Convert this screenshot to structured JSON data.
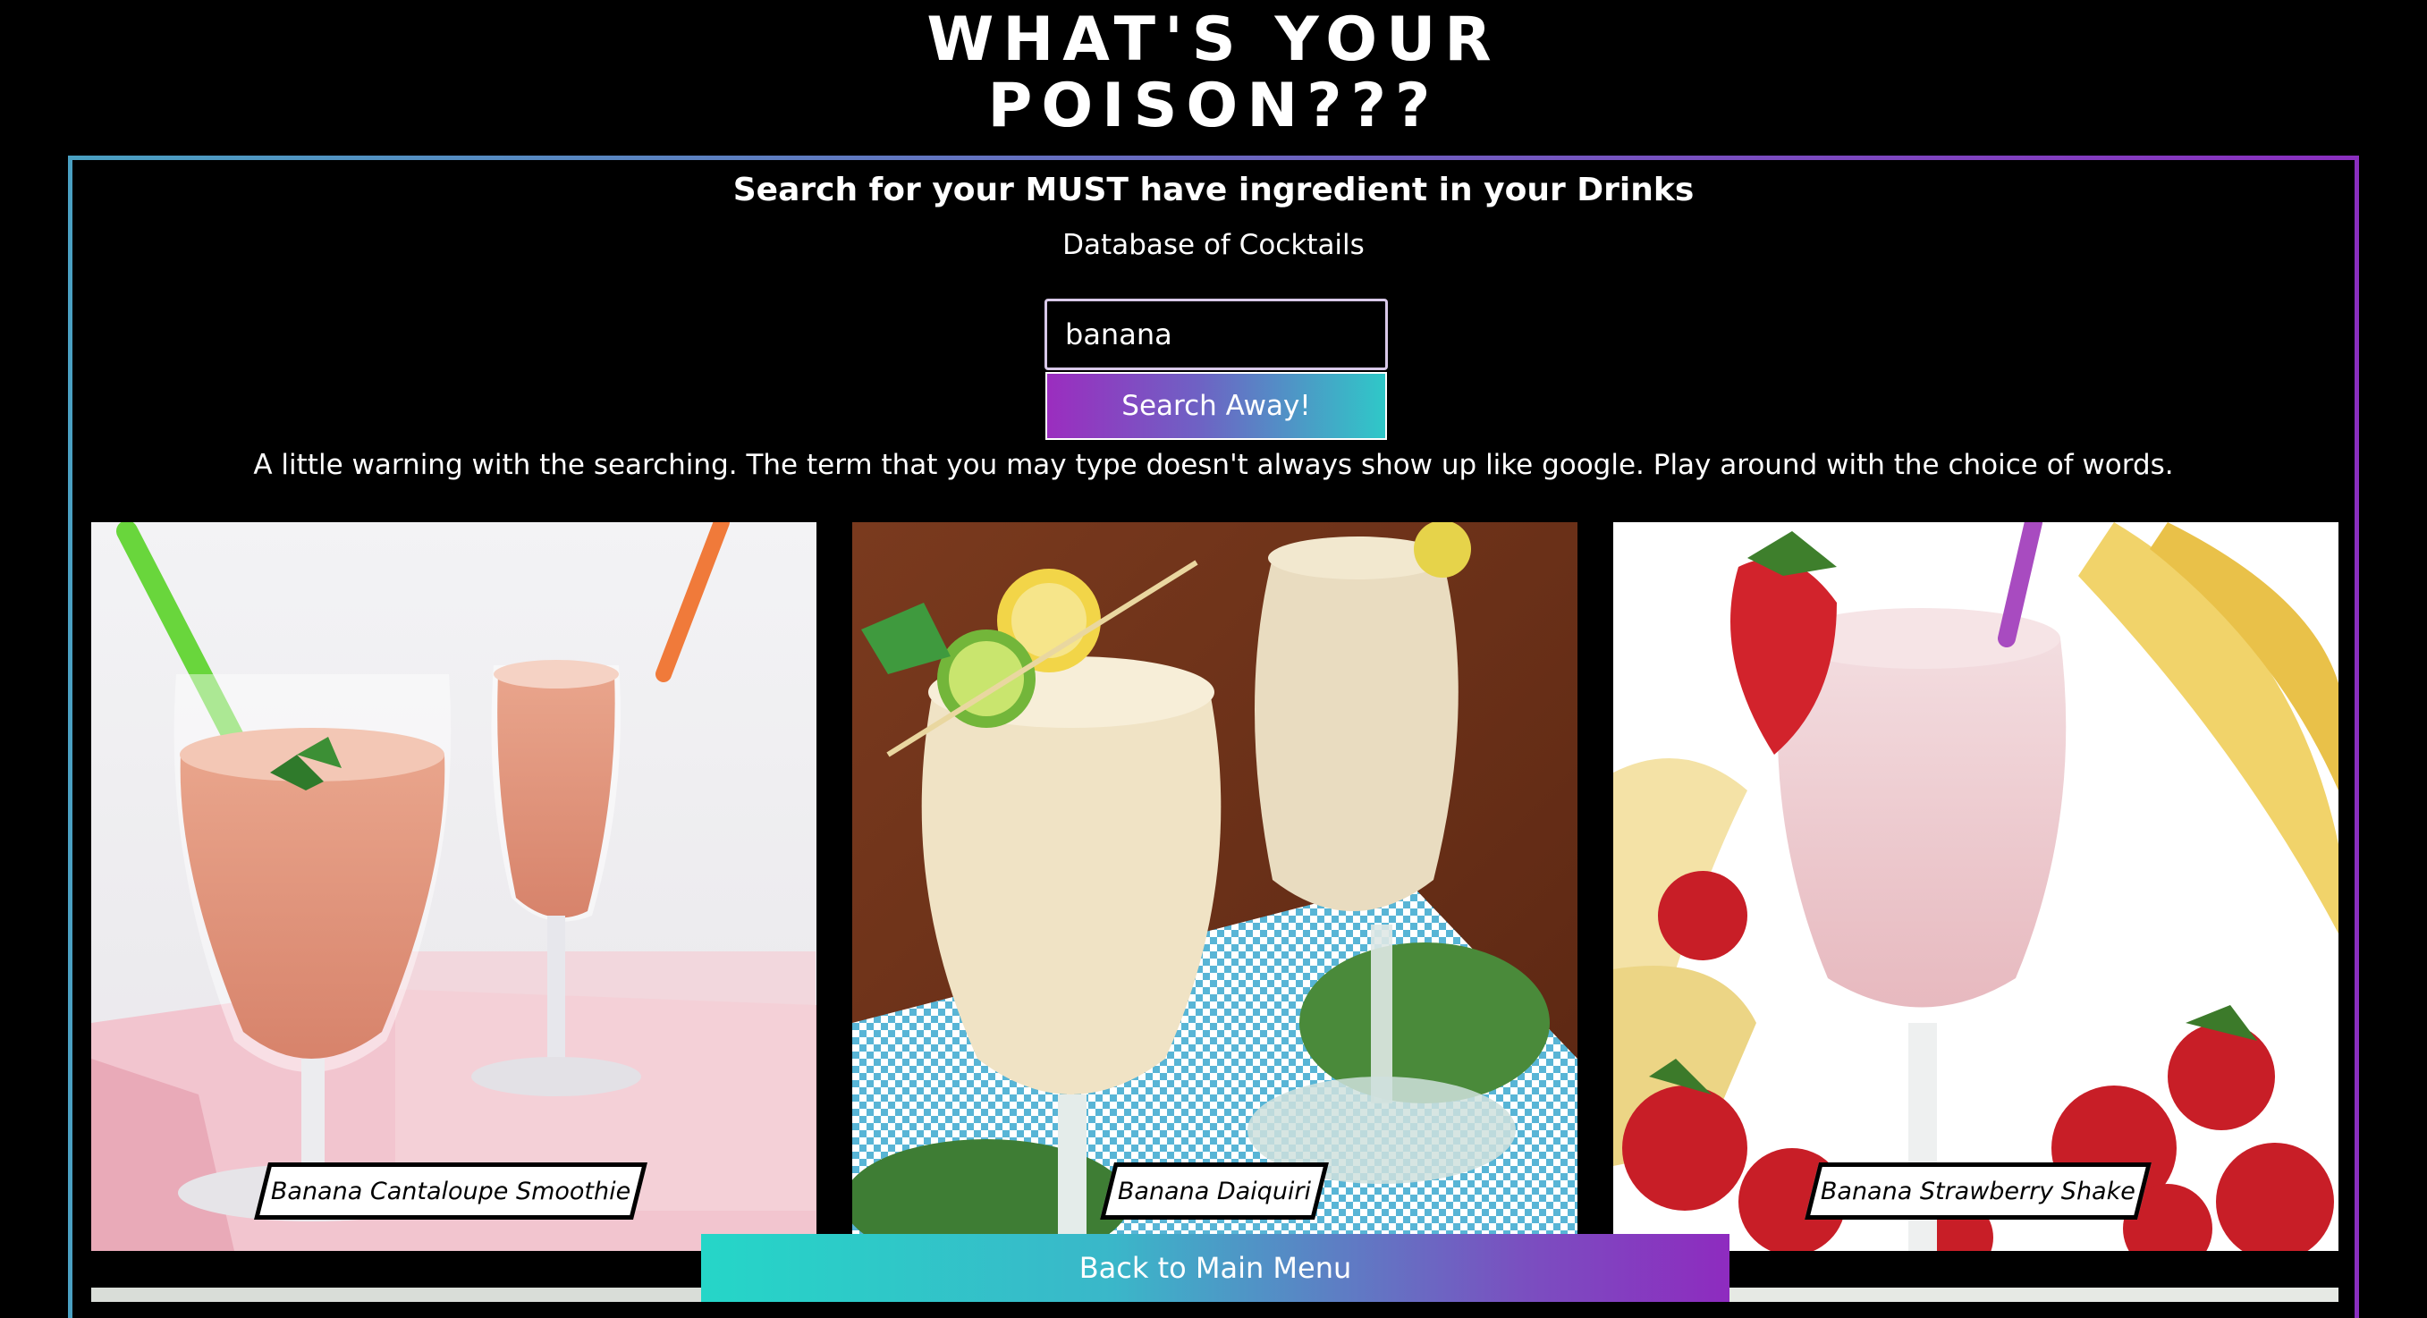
{
  "header": {
    "title_line1": "WHAT'S YOUR",
    "title_line2": "POISON???"
  },
  "search": {
    "heading": "Search for your MUST have ingredient in your Drinks",
    "database_label": "Database of Cocktails",
    "input_value": "banana",
    "button_label": "Search Away!",
    "warning": "A little warning with the searching. The term that you may type doesn't always show up like google. Play around with the choice of words."
  },
  "results": [
    {
      "name": "Banana Cantaloupe Smoothie"
    },
    {
      "name": "Banana Daiquiri"
    },
    {
      "name": "Banana Strawberry Shake"
    }
  ],
  "footer": {
    "back_label": "Back to Main Menu"
  },
  "colors": {
    "background": "#000000",
    "gradient_purple": "#8e2bbf",
    "gradient_teal": "#25d6c8"
  }
}
